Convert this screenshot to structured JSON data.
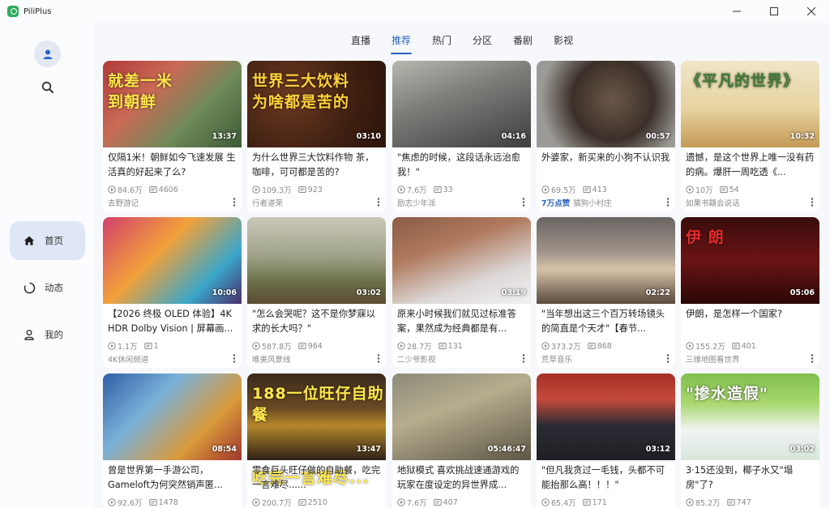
{
  "window": {
    "title": "PiliPlus"
  },
  "nav": [
    {
      "label": "首页",
      "icon": "home-icon",
      "active": true
    },
    {
      "label": "动态",
      "icon": "dynamic-icon",
      "active": false
    },
    {
      "label": "我的",
      "icon": "person-icon",
      "active": false
    }
  ],
  "tabs": [
    {
      "label": "直播",
      "active": false
    },
    {
      "label": "推荐",
      "active": true
    },
    {
      "label": "热门",
      "active": false
    },
    {
      "label": "分区",
      "active": false
    },
    {
      "label": "番剧",
      "active": false
    },
    {
      "label": "影视",
      "active": false
    }
  ],
  "colors": {
    "accent": "#2a63c5",
    "active_nav_bg": "#dfe6f5",
    "logo": "#2faa5f"
  },
  "videos": [
    {
      "overlay": "就差一米\n到朝鲜",
      "duration": "13:37",
      "title": "仅隔1米！朝鲜如今飞速发展 生活真的好起来了么?",
      "views": "84.6万",
      "danmaku": "4606",
      "uploader": "去野游记",
      "badge": "",
      "bg": "linear-gradient(135deg,#b23a3a 0%,#c96b56 35%,#6e8a58 65%,#3d5a36 100%)",
      "overlay_color": "#ffe94a"
    },
    {
      "overlay": "世界三大饮料\n为啥都是苦的",
      "duration": "03:10",
      "title": "为什么世界三大饮料作物 茶，咖啡，可可都是苦的?",
      "views": "109.3万",
      "danmaku": "923",
      "uploader": "行者道荣",
      "badge": "",
      "bg": "radial-gradient(circle at 30% 40%,#6b3a22 0%,#3e1f10 60%,#2a140a 100%)",
      "overlay_color": "#ffd23a"
    },
    {
      "overlay": "",
      "duration": "04:16",
      "title": "\"焦虑的时候，这段话永远治愈我！\"",
      "views": "7.6万",
      "danmaku": "33",
      "uploader": "励志少年派",
      "badge": "",
      "bg": "linear-gradient(160deg,#b8b8b0 0%,#7d7f7a 40%,#3d3f40 100%)",
      "overlay_color": "#ffffff"
    },
    {
      "overlay": "",
      "duration": "00:57",
      "title": "外婆家，新买来的小狗不认识我",
      "views": "69.5万",
      "danmaku": "413",
      "uploader": "猫狗小村庄",
      "badge": "7万点赞",
      "bg": "radial-gradient(circle at 55% 45%,#6b5748 0%,#3b3029 45%,#9c9a96 80%)",
      "overlay_color": "#ffffff"
    },
    {
      "overlay": "《平凡的世界》",
      "duration": "10:32",
      "title": "遗憾，是这个世界上唯一没有药的病。爆肝一周吃透《...",
      "views": "10万",
      "danmaku": "54",
      "uploader": "如果书籍会说话",
      "badge": "",
      "bg": "linear-gradient(180deg,#efe5c8 0%,#e7d39f 55%,#c49a55 100%)",
      "overlay_color": "#3d7a2f"
    },
    {
      "overlay": "",
      "duration": "10:06",
      "title": "【2026 终极 OLED 体验】4K HDR Dolby Vision | 屏幕画...",
      "views": "1.1万",
      "danmaku": "1",
      "uploader": "4K休闲频道",
      "badge": "",
      "bg": "linear-gradient(135deg,#d23f6b 0%,#f2a13b 40%,#3aa7c9 75%,#4b2c6d 100%)",
      "overlay_color": "#ffffff"
    },
    {
      "overlay": "",
      "duration": "03:02",
      "title": "\"怎么会哭呢？这不是你梦寐以求的长大吗？\"",
      "views": "587.8万",
      "danmaku": "964",
      "uploader": "唯美风景线",
      "badge": "",
      "bg": "linear-gradient(180deg,#c9c7b9 0%,#9fa287 45%,#6a6f48 75%,#5b4b33 100%)",
      "overlay_color": "#ffffff"
    },
    {
      "overlay": "",
      "duration": "03:19",
      "title": "原来小时候我们就见过标准答案，果然成为经典都是有...",
      "views": "28.7万",
      "danmaku": "131",
      "uploader": "二少爷影视",
      "badge": "",
      "bg": "linear-gradient(160deg,#8a5a45 0%,#b07a5e 35%,#dcd7d6 70%,#f2f2f2 100%)",
      "overlay_color": "#ffffff"
    },
    {
      "overlay": "",
      "duration": "02:22",
      "title": "\"当年想出这三个百万转场镜头的简直是个天才\"【春节...",
      "views": "373.2万",
      "danmaku": "868",
      "uploader": "荒草音乐",
      "badge": "",
      "bg": "linear-gradient(180deg,#6a6462 0%,#a0948a 40%,#d5c2a8 60%,#5a4a3c 100%)",
      "overlay_color": "#ffffff"
    },
    {
      "overlay": "伊 朗",
      "duration": "05:06",
      "title": "伊朗，是怎样一个国家?",
      "views": "155.2万",
      "danmaku": "401",
      "uploader": "三维地图看世界",
      "badge": "",
      "bg": "linear-gradient(180deg,#3a0c0c 0%,#6b1414 50%,#2a0606 100%)",
      "overlay_color": "#e62a2a"
    },
    {
      "overlay": "",
      "duration": "08:54",
      "title": "曾是世界第一手游公司，Gameloft为何突然销声匿...",
      "views": "92.6万",
      "danmaku": "1478",
      "uploader": "",
      "badge": "",
      "bg": "linear-gradient(135deg,#2f5fa8 0%,#7ab1d8 35%,#d99b3c 70%,#a1352b 100%)",
      "overlay_color": "#ffe94a"
    },
    {
      "overlay": "188一位旺仔自助餐\n\n\n吃完一言难尽...",
      "duration": "13:47",
      "title": "零食巨头旺仔做的自助餐，吃完一言难尽......",
      "views": "200.7万",
      "danmaku": "2510",
      "uploader": "",
      "badge": "",
      "bg": "linear-gradient(180deg,#3a2a1c 0%,#6a4a24 40%,#b5882c 60%,#2e2016 100%)",
      "overlay_color": "#ffe94a"
    },
    {
      "overlay": "",
      "duration": "05:46:47",
      "title": "地狱模式 喜欢挑战速通游戏的玩家在度设定的异世界成...",
      "views": "7.6万",
      "danmaku": "407",
      "uploader": "",
      "badge": "",
      "bg": "linear-gradient(160deg,#8c8a78 0%,#b6ad8e 40%,#5d5746 100%)",
      "overlay_color": "#ffffff"
    },
    {
      "overlay": "",
      "duration": "03:12",
      "title": "\"但凡我贪过一毛钱，头都不可能抬那么高！！！\"",
      "views": "65.4万",
      "danmaku": "171",
      "uploader": "",
      "badge": "",
      "bg": "linear-gradient(180deg,#a53028 0%,#c44a3c 30%,#2b2b33 60%,#1f1f25 100%)",
      "overlay_color": "#ffffff"
    },
    {
      "overlay": "\"掺水造假\"",
      "duration": "03:02",
      "title": "3·15还没到，椰子水又\"塌房\"了?",
      "views": "85.2万",
      "danmaku": "747",
      "uploader": "",
      "badge": "",
      "bg": "linear-gradient(180deg,#7fbf4c 0%,#a9d870 35%,#f1f4f2 65%,#d7e6dc 100%)",
      "overlay_color": "#ffffff"
    }
  ]
}
